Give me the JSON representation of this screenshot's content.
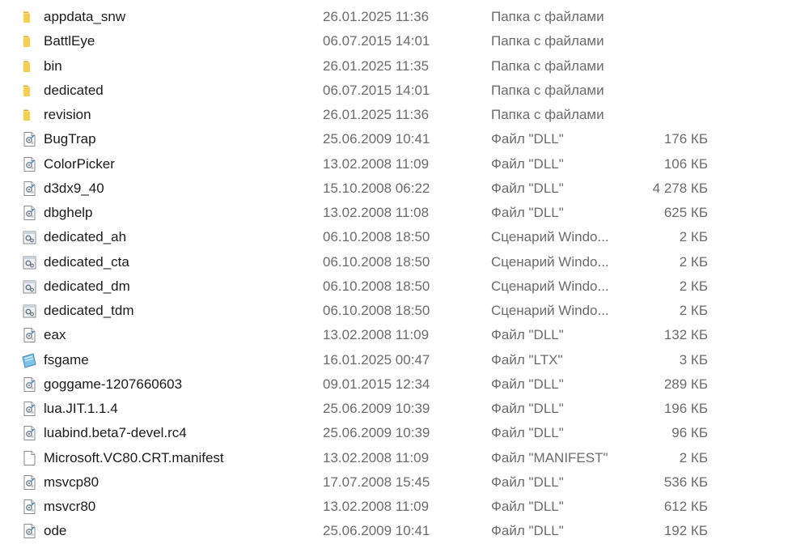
{
  "files": [
    {
      "name": "appdata_snw",
      "date": "26.01.2025 11:36",
      "type": "Папка с файлами",
      "size": "",
      "icon": "folder-icon"
    },
    {
      "name": "BattlEye",
      "date": "06.07.2015 14:01",
      "type": "Папка с файлами",
      "size": "",
      "icon": "folder-icon"
    },
    {
      "name": "bin",
      "date": "26.01.2025 11:35",
      "type": "Папка с файлами",
      "size": "",
      "icon": "folder-icon"
    },
    {
      "name": "dedicated",
      "date": "06.07.2015 14:01",
      "type": "Папка с файлами",
      "size": "",
      "icon": "folder-icon"
    },
    {
      "name": "revision",
      "date": "26.01.2025 11:36",
      "type": "Папка с файлами",
      "size": "",
      "icon": "folder-icon"
    },
    {
      "name": "BugTrap",
      "date": "25.06.2009 10:41",
      "type": "Файл \"DLL\"",
      "size": "176 КБ",
      "icon": "dll-file-icon"
    },
    {
      "name": "ColorPicker",
      "date": "13.02.2008 11:09",
      "type": "Файл \"DLL\"",
      "size": "106 КБ",
      "icon": "dll-file-icon"
    },
    {
      "name": "d3dx9_40",
      "date": "15.10.2008 06:22",
      "type": "Файл \"DLL\"",
      "size": "4 278 КБ",
      "icon": "dll-file-icon"
    },
    {
      "name": "dbghelp",
      "date": "13.02.2008 11:08",
      "type": "Файл \"DLL\"",
      "size": "625 КБ",
      "icon": "dll-file-icon"
    },
    {
      "name": "dedicated_ah",
      "date": "06.10.2008 18:50",
      "type": "Сценарий Windo...",
      "size": "2 КБ",
      "icon": "script-file-icon"
    },
    {
      "name": "dedicated_cta",
      "date": "06.10.2008 18:50",
      "type": "Сценарий Windo...",
      "size": "2 КБ",
      "icon": "script-file-icon"
    },
    {
      "name": "dedicated_dm",
      "date": "06.10.2008 18:50",
      "type": "Сценарий Windo...",
      "size": "2 КБ",
      "icon": "script-file-icon"
    },
    {
      "name": "dedicated_tdm",
      "date": "06.10.2008 18:50",
      "type": "Сценарий Windo...",
      "size": "2 КБ",
      "icon": "script-file-icon"
    },
    {
      "name": "eax",
      "date": "13.02.2008 11:09",
      "type": "Файл \"DLL\"",
      "size": "132 КБ",
      "icon": "dll-file-icon"
    },
    {
      "name": "fsgame",
      "date": "16.01.2025 00:47",
      "type": "Файл \"LTX\"",
      "size": "3 КБ",
      "icon": "ltx-file-icon"
    },
    {
      "name": "goggame-1207660603",
      "date": "09.01.2015 12:34",
      "type": "Файл \"DLL\"",
      "size": "289 КБ",
      "icon": "dll-file-icon"
    },
    {
      "name": "lua.JIT.1.1.4",
      "date": "25.06.2009 10:39",
      "type": "Файл \"DLL\"",
      "size": "196 КБ",
      "icon": "dll-file-icon"
    },
    {
      "name": "luabind.beta7-devel.rc4",
      "date": "25.06.2009 10:39",
      "type": "Файл \"DLL\"",
      "size": "96 КБ",
      "icon": "dll-file-icon"
    },
    {
      "name": "Microsoft.VC80.CRT.manifest",
      "date": "13.02.2008 11:09",
      "type": "Файл \"MANIFEST\"",
      "size": "2 КБ",
      "icon": "blank-file-icon"
    },
    {
      "name": "msvcp80",
      "date": "17.07.2008 15:45",
      "type": "Файл \"DLL\"",
      "size": "536 КБ",
      "icon": "dll-file-icon"
    },
    {
      "name": "msvcr80",
      "date": "13.02.2008 11:09",
      "type": "Файл \"DLL\"",
      "size": "612 КБ",
      "icon": "dll-file-icon"
    },
    {
      "name": "ode",
      "date": "25.06.2009 10:41",
      "type": "Файл \"DLL\"",
      "size": "192 КБ",
      "icon": "dll-file-icon"
    }
  ]
}
